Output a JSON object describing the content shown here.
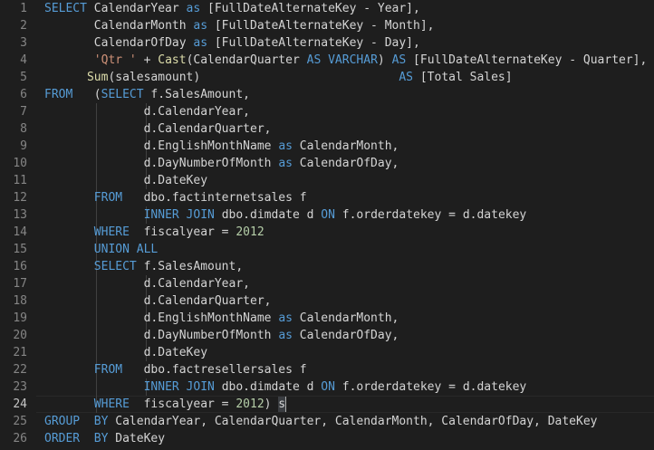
{
  "editor": {
    "active_line": 24,
    "lines": [
      {
        "n": "1",
        "indent": 0,
        "tokens": [
          [
            "kw",
            "SELECT"
          ],
          [
            "id",
            " CalendarYear "
          ],
          [
            "kw",
            "as"
          ],
          [
            "id",
            " [FullDateAlternateKey - Year],"
          ]
        ]
      },
      {
        "n": "2",
        "indent": 7,
        "tokens": [
          [
            "id",
            "CalendarMonth "
          ],
          [
            "kw",
            "as"
          ],
          [
            "id",
            " [FullDateAlternateKey - Month],"
          ]
        ]
      },
      {
        "n": "3",
        "indent": 7,
        "tokens": [
          [
            "id",
            "CalendarOfDay "
          ],
          [
            "kw",
            "as"
          ],
          [
            "id",
            " [FullDateAlternateKey - Day],"
          ]
        ]
      },
      {
        "n": "4",
        "indent": 7,
        "tokens": [
          [
            "str",
            "'Qtr '"
          ],
          [
            "id",
            " + "
          ],
          [
            "fn",
            "Cast"
          ],
          [
            "id",
            "(CalendarQuarter "
          ],
          [
            "kw",
            "AS"
          ],
          [
            "id",
            " "
          ],
          [
            "kw",
            "VARCHAR"
          ],
          [
            "id",
            ") "
          ],
          [
            "kw",
            "AS"
          ],
          [
            "id",
            " [FullDateAlternateKey - Quarter],"
          ]
        ]
      },
      {
        "n": "5",
        "indent": 6,
        "tokens": [
          [
            "fn",
            "Sum"
          ],
          [
            "id",
            "(salesamount)                            "
          ],
          [
            "kw",
            "AS"
          ],
          [
            "id",
            " [Total Sales]"
          ]
        ]
      },
      {
        "n": "6",
        "indent": 0,
        "tokens": [
          [
            "kw",
            "FROM"
          ],
          [
            "id",
            "   ("
          ],
          [
            "kw",
            "SELECT"
          ],
          [
            "id",
            " f.SalesAmount,"
          ]
        ]
      },
      {
        "n": "7",
        "indent": 14,
        "tokens": [
          [
            "id",
            "d.CalendarYear,"
          ]
        ]
      },
      {
        "n": "8",
        "indent": 14,
        "tokens": [
          [
            "id",
            "d.CalendarQuarter,"
          ]
        ]
      },
      {
        "n": "9",
        "indent": 14,
        "tokens": [
          [
            "id",
            "d.EnglishMonthName "
          ],
          [
            "kw",
            "as"
          ],
          [
            "id",
            " CalendarMonth,"
          ]
        ]
      },
      {
        "n": "10",
        "indent": 14,
        "tokens": [
          [
            "id",
            "d.DayNumberOfMonth "
          ],
          [
            "kw",
            "as"
          ],
          [
            "id",
            " CalendarOfDay,"
          ]
        ]
      },
      {
        "n": "11",
        "indent": 14,
        "tokens": [
          [
            "id",
            "d.DateKey"
          ]
        ]
      },
      {
        "n": "12",
        "indent": 7,
        "tokens": [
          [
            "kw",
            "FROM"
          ],
          [
            "id",
            "   dbo.factinternetsales f"
          ]
        ]
      },
      {
        "n": "13",
        "indent": 14,
        "tokens": [
          [
            "kw",
            "INNER JOIN"
          ],
          [
            "id",
            " dbo.dimdate d "
          ],
          [
            "kw",
            "ON"
          ],
          [
            "id",
            " f.orderdatekey = d.datekey"
          ]
        ]
      },
      {
        "n": "14",
        "indent": 7,
        "tokens": [
          [
            "kw",
            "WHERE"
          ],
          [
            "id",
            "  fiscalyear = "
          ],
          [
            "num",
            "2012"
          ]
        ]
      },
      {
        "n": "15",
        "indent": 7,
        "tokens": [
          [
            "kw",
            "UNION ALL"
          ]
        ]
      },
      {
        "n": "16",
        "indent": 7,
        "tokens": [
          [
            "kw",
            "SELECT"
          ],
          [
            "id",
            " f.SalesAmount,"
          ]
        ]
      },
      {
        "n": "17",
        "indent": 14,
        "tokens": [
          [
            "id",
            "d.CalendarYear,"
          ]
        ]
      },
      {
        "n": "18",
        "indent": 14,
        "tokens": [
          [
            "id",
            "d.CalendarQuarter,"
          ]
        ]
      },
      {
        "n": "19",
        "indent": 14,
        "tokens": [
          [
            "id",
            "d.EnglishMonthName "
          ],
          [
            "kw",
            "as"
          ],
          [
            "id",
            " CalendarMonth,"
          ]
        ]
      },
      {
        "n": "20",
        "indent": 14,
        "tokens": [
          [
            "id",
            "d.DayNumberOfMonth "
          ],
          [
            "kw",
            "as"
          ],
          [
            "id",
            " CalendarOfDay,"
          ]
        ]
      },
      {
        "n": "21",
        "indent": 14,
        "tokens": [
          [
            "id",
            "d.DateKey"
          ]
        ]
      },
      {
        "n": "22",
        "indent": 7,
        "tokens": [
          [
            "kw",
            "FROM"
          ],
          [
            "id",
            "   dbo.factresellersales f"
          ]
        ]
      },
      {
        "n": "23",
        "indent": 14,
        "tokens": [
          [
            "kw",
            "INNER JOIN"
          ],
          [
            "id",
            " dbo.dimdate d "
          ],
          [
            "kw",
            "ON"
          ],
          [
            "id",
            " f.orderdatekey = d.datekey"
          ]
        ]
      },
      {
        "n": "24",
        "indent": 7,
        "tokens": [
          [
            "kw",
            "WHERE"
          ],
          [
            "id",
            "  fiscalyear = "
          ],
          [
            "num",
            "2012"
          ],
          [
            "id",
            ") s"
          ]
        ]
      },
      {
        "n": "25",
        "indent": 0,
        "tokens": [
          [
            "kw",
            "GROUP"
          ],
          [
            "id",
            "  "
          ],
          [
            "kw",
            "BY"
          ],
          [
            "id",
            " CalendarYear, CalendarQuarter, CalendarMonth, CalendarOfDay, DateKey"
          ]
        ]
      },
      {
        "n": "26",
        "indent": 0,
        "tokens": [
          [
            "kw",
            "ORDER"
          ],
          [
            "id",
            "  "
          ],
          [
            "kw",
            "BY"
          ],
          [
            "id",
            " DateKey"
          ]
        ]
      }
    ],
    "colors": {
      "background": "#1e1e1e",
      "line_number": "#858585",
      "active_line_number": "#c6c6c6",
      "keyword": "#569cd6",
      "function": "#dcdcaa",
      "string": "#ce9178",
      "number": "#b5cea8",
      "identifier": "#d4d4d4"
    }
  }
}
